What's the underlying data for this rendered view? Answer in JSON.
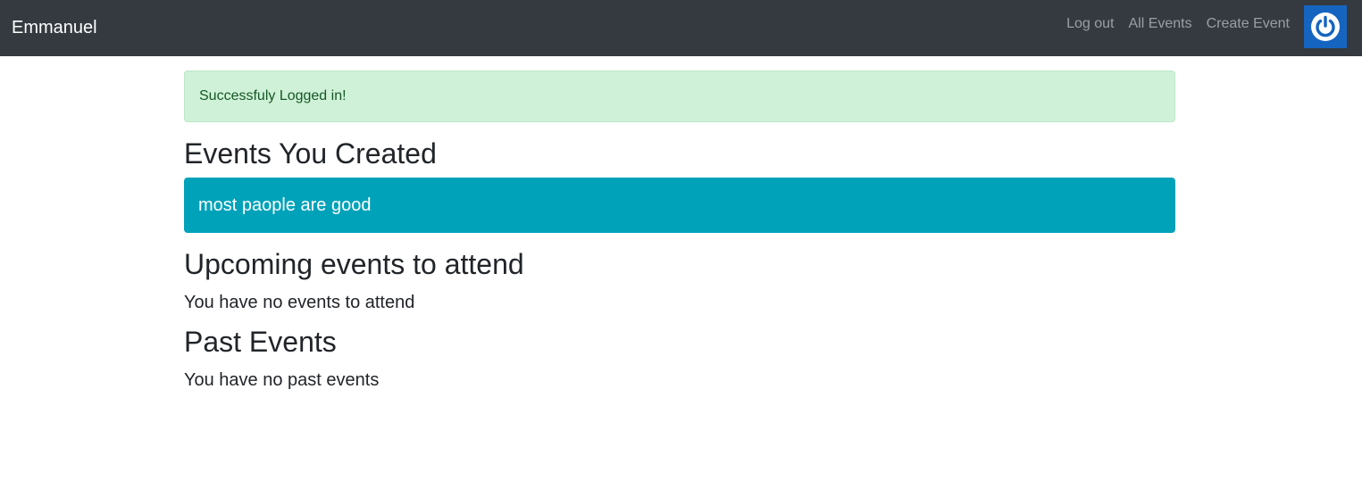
{
  "navbar": {
    "brand": "Emmanuel",
    "links": [
      {
        "label": "Log out"
      },
      {
        "label": "All Events"
      },
      {
        "label": "Create Event"
      }
    ],
    "avatar_icon": "power-icon",
    "avatar_color": "#1565c0",
    "background": "#343a40"
  },
  "alert": {
    "message": "Successfuly Logged in!",
    "color": "#cff1d8"
  },
  "sections": {
    "created": {
      "title": "Events You Created",
      "events": [
        {
          "title": "most paople are good",
          "color": "#00a2ba"
        }
      ]
    },
    "upcoming": {
      "title": "Upcoming events to attend",
      "empty_text": "You have no events to attend"
    },
    "past": {
      "title": "Past Events",
      "empty_text": "You have no past events"
    }
  }
}
